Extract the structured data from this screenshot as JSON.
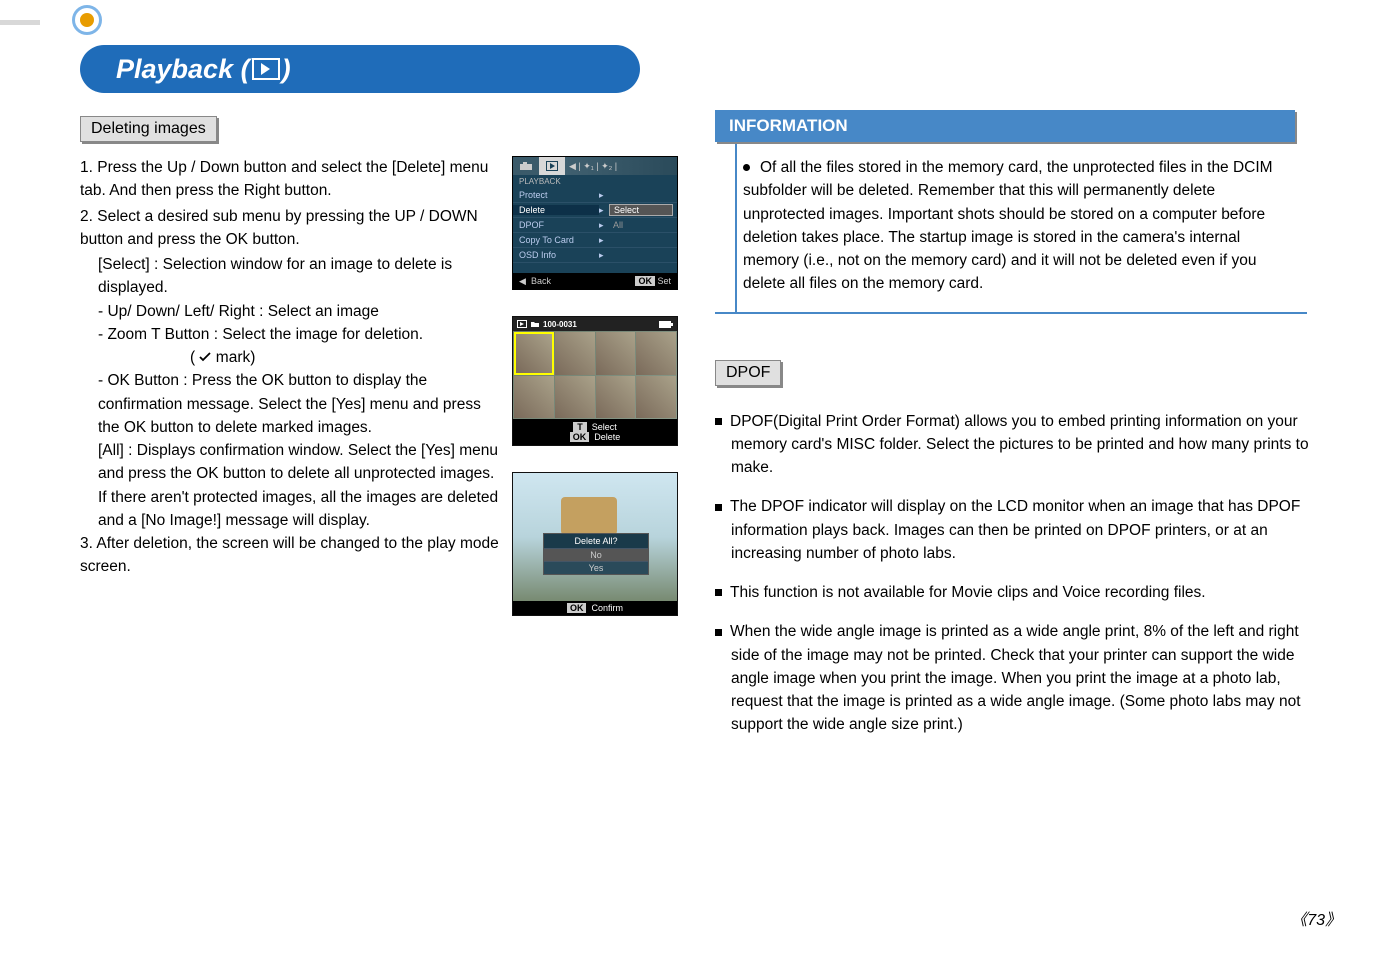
{
  "title": {
    "prefix": "Playback (",
    "suffix": ")"
  },
  "left": {
    "section_heading": "Deleting images",
    "step1": "1. Press the Up / Down button and select the [Delete] menu tab. And then press the Right button.",
    "step2": "2. Select a desired sub menu by pressing the UP / DOWN button and press the OK button.",
    "select_head": "[Select] : Selection window for an image to delete is displayed.",
    "line_updown": "- Up/ Down/ Left/ Right : Select an image",
    "line_zoom1": "- Zoom T Button : Select the image for deletion.",
    "line_zoom2_pre": "(",
    "line_zoom2_post": " mark)",
    "line_ok1": "- OK Button : Press the OK button to display the confirmation message. Select the [Yes] menu and press the OK button to delete marked images.",
    "all_head": "[All] : Displays confirmation window. Select the [Yes] menu and press the OK button to delete all unprotected images. If there aren't protected images, all the images are deleted and a [No Image!] message will display.",
    "step3": "3. After deletion, the screen will be changed to the play mode screen."
  },
  "lcd": {
    "tab_label": "PLAYBACK",
    "rows": {
      "protect": "Protect",
      "delete": "Delete",
      "dpof": "DPOF",
      "copy": "Copy To Card",
      "osd": "OSD Info",
      "sel": "Select",
      "all": "All"
    },
    "bottom": {
      "back_icon": "◀",
      "back": "Back",
      "ok": "OK",
      "set": "Set"
    }
  },
  "thumb": {
    "folder": "100-0031",
    "t": "T",
    "t_label": "Select",
    "ok": "OK",
    "ok_label": "Delete"
  },
  "confirm": {
    "title": "Delete All?",
    "no": "No",
    "yes": "Yes",
    "ok": "OK",
    "ok_label": "Confirm"
  },
  "info": {
    "header": "INFORMATION",
    "text": "Of all the files stored in the memory card, the unprotected files in the DCIM subfolder will be deleted. Remember that this will permanently delete unprotected images. Important shots should be stored on a computer before deletion takes place. The startup image is stored in the camera's internal memory (i.e., not on the memory card) and it will not be deleted even if you delete all files on the memory card."
  },
  "dpof": {
    "heading": "DPOF",
    "p1": "DPOF(Digital Print Order Format) allows you to embed printing information on your memory card's MISC folder. Select the pictures to be printed and how many prints to make.",
    "p2": "The DPOF indicator will display on the LCD monitor when an image that has DPOF information plays back. Images can then be printed on DPOF printers, or at an increasing number of photo labs.",
    "p3": "This function is not available for Movie clips and Voice recording files.",
    "p4": "When the wide angle image is printed as a wide angle print, 8% of the left and right side of the image may not be printed. Check that your printer can support the wide angle image when you print the image. When you print the image at a photo lab, request that the image is printed as a wide angle image. (Some photo labs may not support the wide angle size print.)"
  },
  "page_number": "73"
}
